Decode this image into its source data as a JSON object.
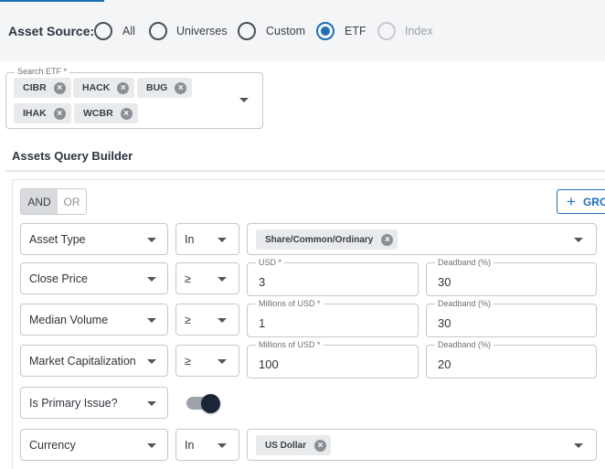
{
  "asset_source": {
    "label": "Asset Source:",
    "options": [
      {
        "label": "All",
        "state": "unchecked"
      },
      {
        "label": "Universes",
        "state": "unchecked"
      },
      {
        "label": "Custom",
        "state": "unchecked"
      },
      {
        "label": "ETF",
        "state": "checked"
      },
      {
        "label": "Index",
        "state": "disabled"
      }
    ]
  },
  "search_etf": {
    "legend": "Search ETF *",
    "chips": [
      "CIBR",
      "HACK",
      "BUG",
      "IHAK",
      "WCBR"
    ]
  },
  "query_builder": {
    "title": "Assets Query Builder",
    "and_label": "AND",
    "or_label": "OR",
    "group_label": "GRO",
    "rows": [
      {
        "field": "Asset Type",
        "operator": "In",
        "value_chip": "Share/Common/Ordinary"
      },
      {
        "field": "Close Price",
        "operator": "≥",
        "value_legend": "USD *",
        "value": "3",
        "deadband_legend": "Deadband (%)",
        "deadband": "30"
      },
      {
        "field": "Median Volume",
        "operator": "≥",
        "value_legend": "Millions of USD *",
        "value": "1",
        "deadband_legend": "Deadband (%)",
        "deadband": "30"
      },
      {
        "field": "Market Capitalization",
        "operator": "≥",
        "value_legend": "Millions of USD *",
        "value": "100",
        "deadband_legend": "Deadband (%)",
        "deadband": "20"
      },
      {
        "field": "Is Primary Issue?",
        "toggle_on": true
      },
      {
        "field": "Currency",
        "operator": "In",
        "value_chip": "US Dollar"
      }
    ]
  },
  "colors": {
    "accent": "#1e6fb8",
    "toggle_knob": "#1c2538"
  },
  "icons": {
    "chip_remove": "cancel-circle-icon",
    "dropdown": "caret-down-icon",
    "add": "plus-icon"
  }
}
